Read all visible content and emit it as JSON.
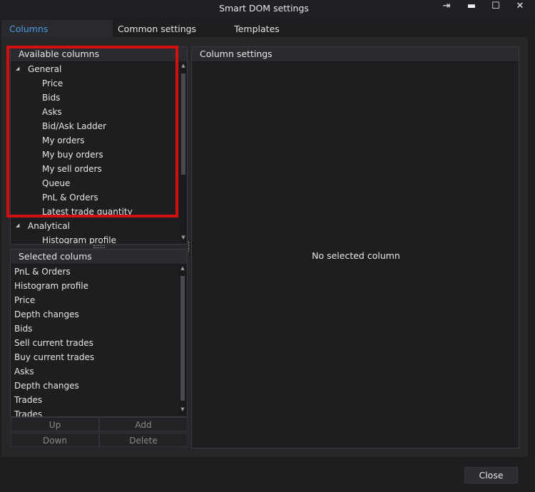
{
  "window": {
    "title": "Smart DOM settings",
    "controls": {
      "pin": "⇥",
      "minimize": "▬",
      "maximize": "☐",
      "close": "✕"
    }
  },
  "tabs": [
    {
      "label": "Columns",
      "active": true
    },
    {
      "label": "Common settings",
      "active": false
    },
    {
      "label": "Templates",
      "active": false
    }
  ],
  "available_columns": {
    "header": "Available columns",
    "groups": [
      {
        "label": "General",
        "items": [
          "Price",
          "Bids",
          "Asks",
          "Bid/Ask Ladder",
          "My orders",
          "My buy orders",
          "My sell orders",
          "Queue",
          "PnL & Orders",
          "Latest trade quantity"
        ]
      },
      {
        "label": "Analytical",
        "items": [
          "Histogram profile"
        ]
      }
    ]
  },
  "selected_columns": {
    "header": "Selected colums",
    "items": [
      "PnL & Orders",
      "Histogram profile",
      "Price",
      "Depth changes",
      "Bids",
      "Sell current trades",
      "Buy current trades",
      "Asks",
      "Depth changes",
      "Trades",
      "Trades"
    ]
  },
  "actions": {
    "up": "Up",
    "add": "Add",
    "down": "Down",
    "delete": "Delete"
  },
  "column_settings": {
    "header": "Column settings",
    "empty_message": "No selected column"
  },
  "footer": {
    "close": "Close"
  },
  "colors": {
    "accent": "#4c9be8",
    "highlight": "#d40f0f",
    "background": "#1e1e21"
  }
}
